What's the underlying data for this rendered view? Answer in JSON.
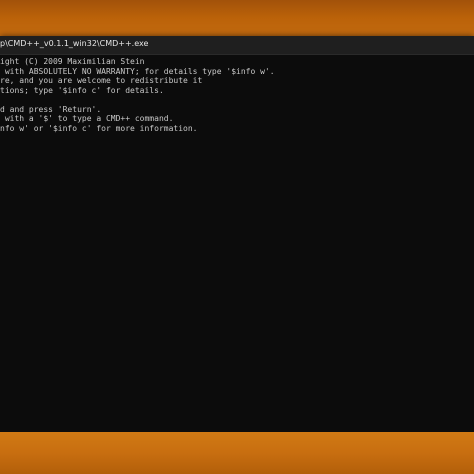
{
  "window": {
    "title": "p\\CMD++_v0.1.1_win32\\CMD++.exe"
  },
  "console": {
    "lines": [
      "ight (C) 2009 Maximilian Stein",
      " with ABSOLUTELY NO WARRANTY; for details type '$info w'.",
      "re, and you are welcome to redistribute it",
      "tions; type '$info c' for details.",
      "",
      "d and press 'Return'.",
      " with a '$' to type a CMD++ command.",
      "nfo w' or '$info c' for more information."
    ]
  },
  "colors": {
    "console_background": "#0c0c0c",
    "console_text": "#c8c8c8",
    "title_bar": "#1f1f1f",
    "desktop_orange": "#c96c0c"
  }
}
